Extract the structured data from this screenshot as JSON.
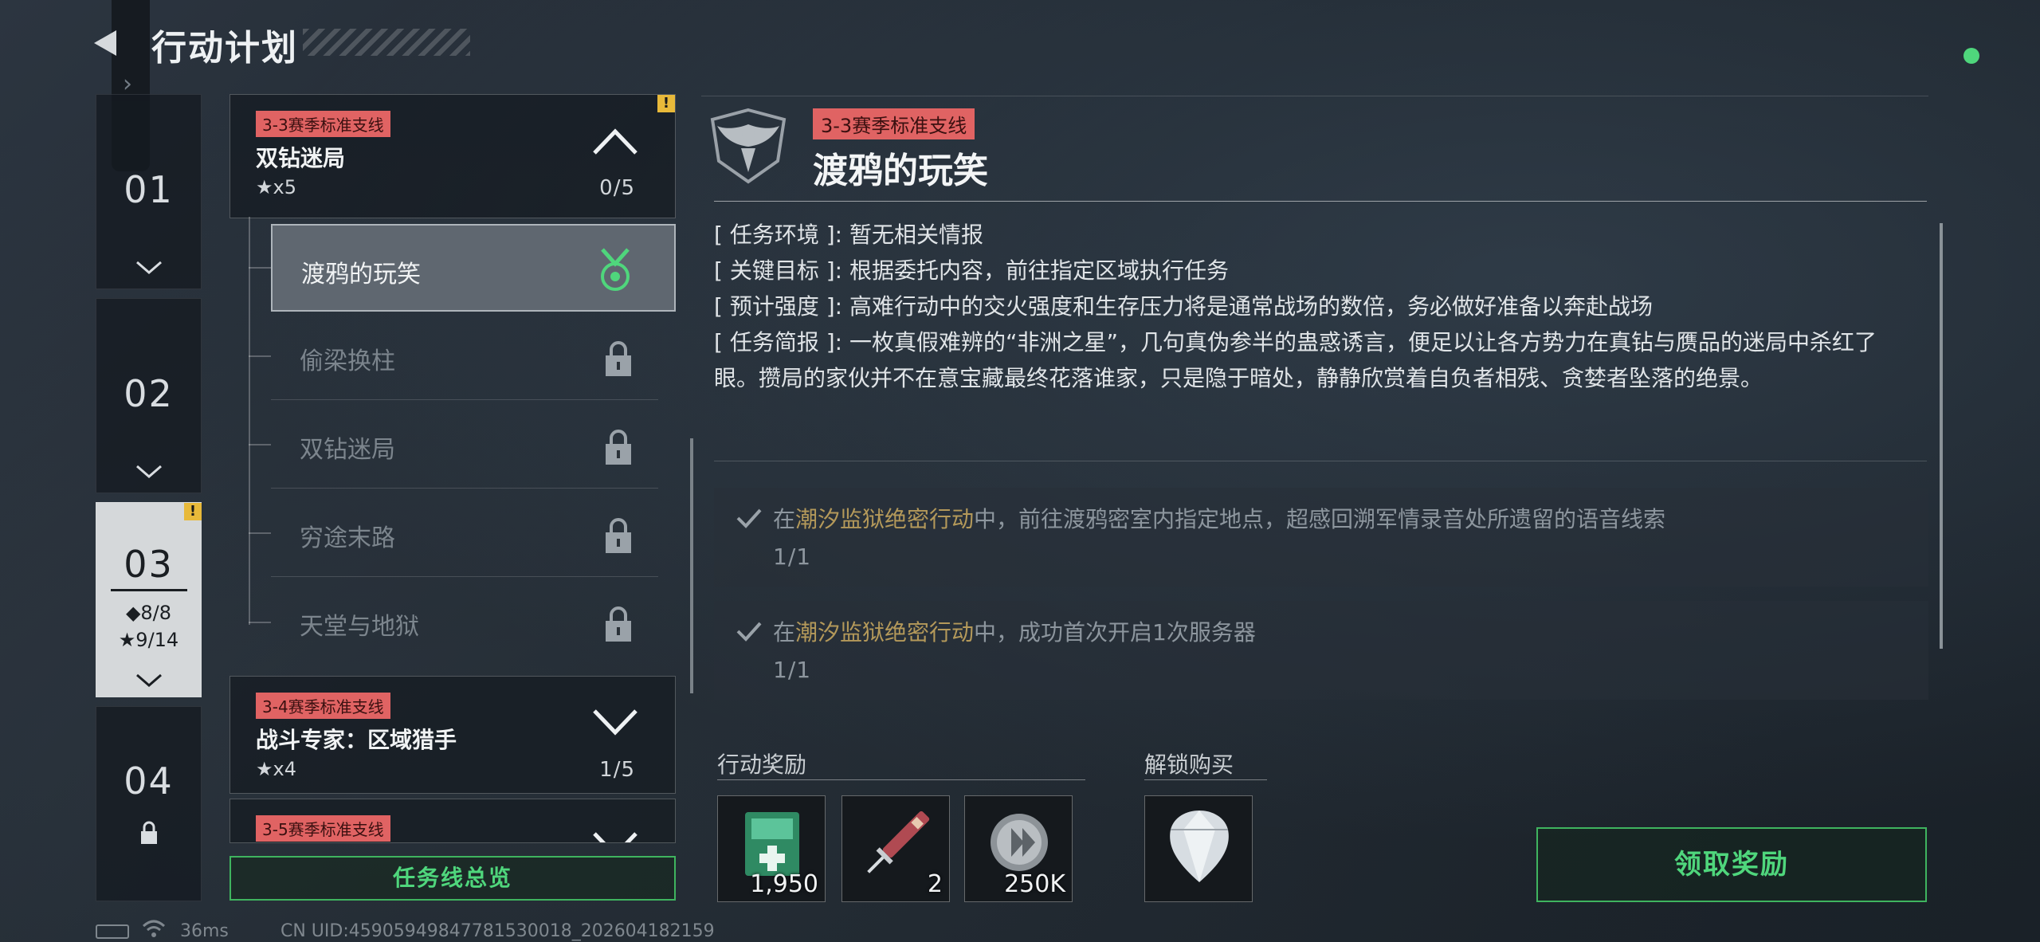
{
  "header": {
    "title": "行动计划"
  },
  "chapters": [
    {
      "number": "01"
    },
    {
      "number": "02"
    },
    {
      "number": "03",
      "alert": "!",
      "diamonds": "◆8/8",
      "stars": "★9/14"
    },
    {
      "number": "04"
    }
  ],
  "mission_groups": [
    {
      "tag": "3-3赛季标准支线",
      "name": "双钻迷局",
      "stars": "★x5",
      "progress": "0/5",
      "alert": "!"
    },
    {
      "tag": "3-4赛季标准支线",
      "name": "战斗专家：区域猎手",
      "stars": "★x4",
      "progress": "1/5"
    },
    {
      "tag": "3-5赛季标准支线"
    }
  ],
  "sub_missions": [
    {
      "label": "渡鸦的玩笑",
      "state": "selected"
    },
    {
      "label": "偷梁换柱",
      "state": "locked"
    },
    {
      "label": "双钻迷局",
      "state": "locked"
    },
    {
      "label": "穷途末路",
      "state": "locked"
    },
    {
      "label": "天堂与地狱",
      "state": "locked"
    }
  ],
  "overview_button": "任务线总览",
  "detail": {
    "tag": "3-3赛季标准支线",
    "title": "渡鸦的玩笑",
    "info": [
      {
        "key": "[ 任务环境 ]",
        "value": "暂无相关情报"
      },
      {
        "key": "[ 关键目标 ]",
        "value": "根据委托内容，前往指定区域执行任务"
      },
      {
        "key": "[ 预计强度 ]",
        "value": "高难行动中的交火强度和生存压力将是通常战场的数倍，务必做好准备以奔赴战场"
      },
      {
        "key": "[ 任务简报 ]",
        "value": "一枚真假难辨的“非洲之星”，几句真伪参半的蛊惑诱言，便足以让各方势力在真钻与赝品的迷局中杀红了眼。攒局的家伙并不在意宝藏最终花落谁家，只是隐于暗处，静静欣赏着自负者相残、贪婪者坠落的绝景。"
      }
    ],
    "info_separator": ":",
    "objectives": [
      {
        "prefix": "在",
        "highlight": "潮汐监狱绝密行动",
        "suffix": "中，前往渡鸦密室内指定地点，超感回溯军情录音处所遗留的语音线索",
        "count": "1/1"
      },
      {
        "prefix": "在",
        "highlight": "潮汐监狱绝密行动",
        "suffix": "中，成功首次开启1次服务器",
        "count": "1/1"
      }
    ]
  },
  "rewards": {
    "label": "行动奖励",
    "items": [
      {
        "icon": "medkit-box-icon",
        "qty": "1,950"
      },
      {
        "icon": "syringe-icon",
        "qty": "2"
      },
      {
        "icon": "coin-icon",
        "qty": "250K"
      }
    ]
  },
  "unlock": {
    "label": "解锁购买",
    "items": [
      {
        "icon": "diamond-icon"
      }
    ]
  },
  "claim_button": "领取奖励",
  "footer": {
    "ping": "36ms",
    "uid": "CN UID:45905949847781530018_202604182159"
  },
  "colors": {
    "accent_green": "#4fd67c",
    "tag_red": "#e06363",
    "alert_yellow": "#e8b93a",
    "objective_highlight": "#b4995a"
  }
}
